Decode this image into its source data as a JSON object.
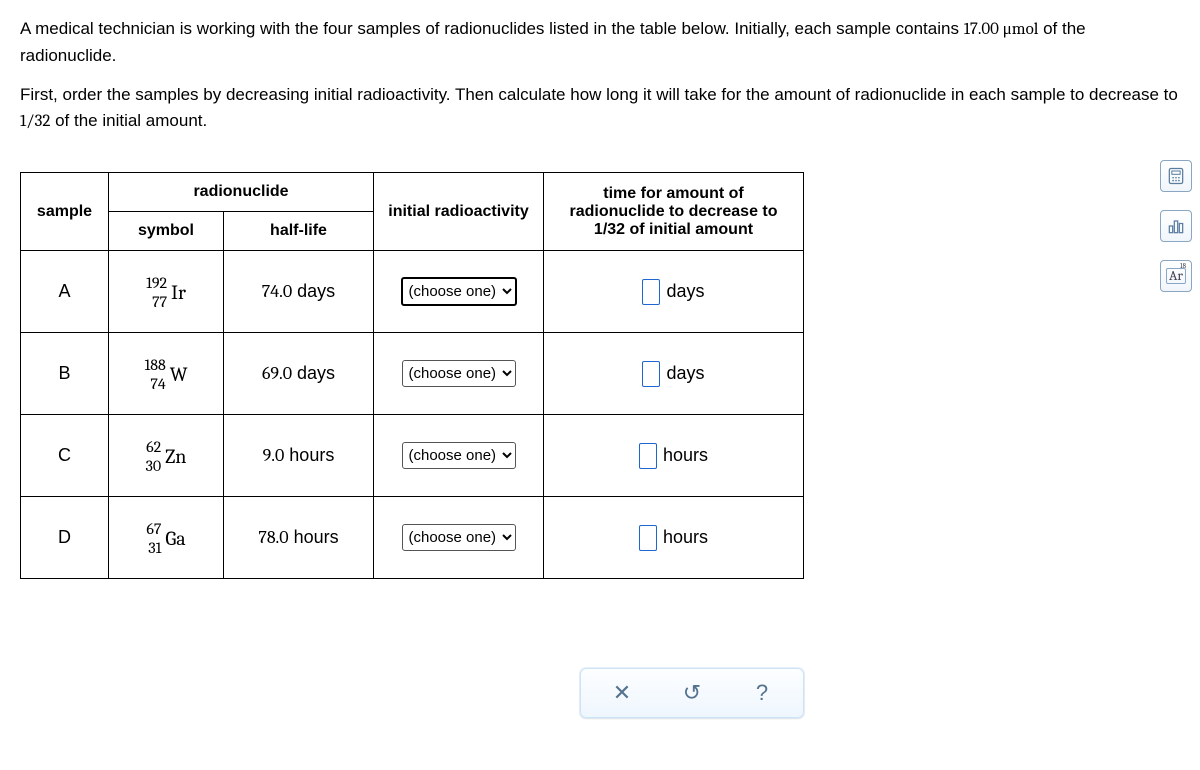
{
  "problem": {
    "p1_a": "A medical technician is working with the four samples of radionuclides listed in the table below. Initially, each sample contains ",
    "p1_amount": "17.00 ",
    "p1_unit": "μmol",
    "p1_b": " of the radionuclide.",
    "p2_a": "First, order the samples by decreasing initial radioactivity. Then calculate how long it will take for the amount of radionuclide in each sample to decrease to ",
    "p2_frac": "1/32",
    "p2_b": " of the initial amount."
  },
  "headers": {
    "sample": "sample",
    "radionuclide": "radionuclide",
    "symbol": "symbol",
    "halflife": "half-life",
    "initial": "initial radioactivity",
    "time": "time for amount of radionuclide to decrease to 1/32 of initial amount"
  },
  "rows": [
    {
      "sample": "A",
      "mass": "192",
      "atomic": "77",
      "sym": "Ir",
      "hlnum": "74.0",
      "hlunit": "days",
      "choose": "(choose one)",
      "timeunit": "days"
    },
    {
      "sample": "B",
      "mass": "188",
      "atomic": "74",
      "sym": "W",
      "hlnum": "69.0",
      "hlunit": "days",
      "choose": "(choose one)",
      "timeunit": "days"
    },
    {
      "sample": "C",
      "mass": "62",
      "atomic": "30",
      "sym": "Zn",
      "hlnum": "9.0",
      "hlunit": "hours",
      "choose": "(choose one)",
      "timeunit": "hours"
    },
    {
      "sample": "D",
      "mass": "67",
      "atomic": "31",
      "sym": "Ga",
      "hlnum": "78.0",
      "hlunit": "hours",
      "choose": "(choose one)",
      "timeunit": "hours"
    }
  ],
  "toolbar": {
    "clear": "✕",
    "reset": "↺",
    "help": "?"
  },
  "side": {
    "ar": "Ar",
    "ar_sup": "18"
  }
}
